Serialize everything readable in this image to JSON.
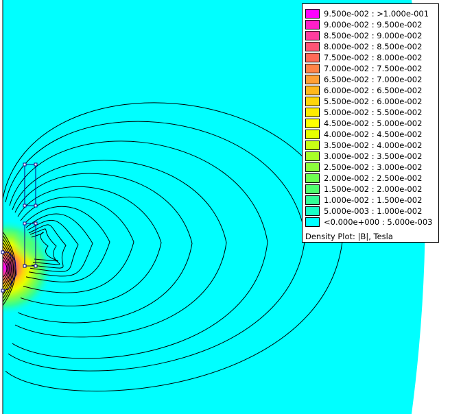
{
  "plot": {
    "background": "#00ffff",
    "outside": "#ffffff",
    "contour_color": "#000000",
    "geometry_color": "#000080"
  },
  "legend": {
    "title": "Density Plot: |B|, Tesla",
    "entries": [
      {
        "label": "9.500e-002 : >1.000e-001",
        "color": "#ff00ff"
      },
      {
        "label": "9.000e-002 : 9.500e-002",
        "color": "#ff1ec8"
      },
      {
        "label": "8.500e-002 : 9.000e-002",
        "color": "#ff3d9e"
      },
      {
        "label": "8.000e-002 : 8.500e-002",
        "color": "#ff5475"
      },
      {
        "label": "7.500e-002 : 8.000e-002",
        "color": "#ff6a58"
      },
      {
        "label": "7.000e-002 : 7.500e-002",
        "color": "#ff8448"
      },
      {
        "label": "6.500e-002 : 7.000e-002",
        "color": "#ffa035"
      },
      {
        "label": "6.000e-002 : 6.500e-002",
        "color": "#ffb81c"
      },
      {
        "label": "5.500e-002 : 6.000e-002",
        "color": "#ffd50a"
      },
      {
        "label": "5.000e-002 : 5.500e-002",
        "color": "#ffec00"
      },
      {
        "label": "4.500e-002 : 5.000e-002",
        "color": "#ffff00"
      },
      {
        "label": "4.000e-002 : 4.500e-002",
        "color": "#e6ff00"
      },
      {
        "label": "3.500e-002 : 4.000e-002",
        "color": "#c8ff14"
      },
      {
        "label": "3.000e-002 : 3.500e-002",
        "color": "#a8ff28"
      },
      {
        "label": "2.500e-002 : 3.000e-002",
        "color": "#8cff3c"
      },
      {
        "label": "2.000e-002 : 2.500e-002",
        "color": "#6eff50"
      },
      {
        "label": "1.500e-002 : 2.000e-002",
        "color": "#50ff6e"
      },
      {
        "label": "1.000e-002 : 1.500e-002",
        "color": "#32ff96"
      },
      {
        "label": "5.000e-003 : 1.000e-002",
        "color": "#18ffc6"
      },
      {
        "label": "<0.000e+000 : 5.000e-003",
        "color": "#00ffff"
      }
    ]
  }
}
